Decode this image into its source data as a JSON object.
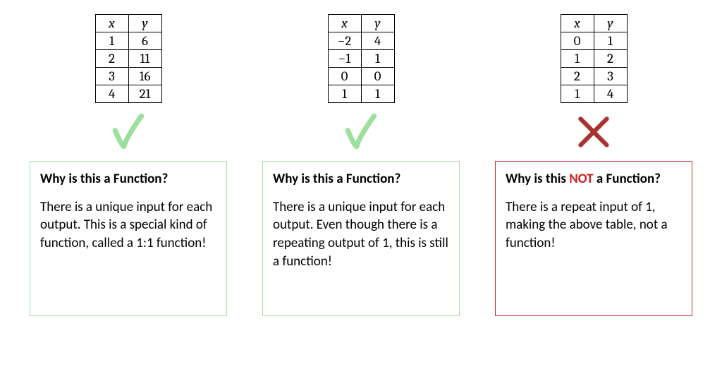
{
  "columns": [
    {
      "table": {
        "headers": [
          "x",
          "y"
        ],
        "rows": [
          [
            "1",
            "6"
          ],
          [
            "2",
            "11"
          ],
          [
            "3",
            "16"
          ],
          [
            "4",
            "21"
          ]
        ]
      },
      "mark": "check",
      "title_pre": "Why is this a Function?",
      "title_emph": "",
      "title_post": "",
      "body": "There is a unique input for each output.  This is a special kind of function, called a 1:1 function!",
      "box_class": "box-green"
    },
    {
      "table": {
        "headers": [
          "x",
          "y"
        ],
        "rows": [
          [
            "−2",
            "4"
          ],
          [
            "−1",
            "1"
          ],
          [
            "0",
            "0"
          ],
          [
            "1",
            "1"
          ]
        ]
      },
      "mark": "check",
      "title_pre": "Why is this a Function?",
      "title_emph": "",
      "title_post": "",
      "body": "There is a unique input for each output. Even though there is a repeating output of 1, this is still a function!",
      "box_class": "box-green"
    },
    {
      "table": {
        "headers": [
          "x",
          "y"
        ],
        "rows": [
          [
            "0",
            "1"
          ],
          [
            "1",
            "2"
          ],
          [
            "2",
            "3"
          ],
          [
            "1",
            "4"
          ]
        ]
      },
      "mark": "cross",
      "title_pre": "Why is this ",
      "title_emph": "NOT",
      "title_post": " a Function?",
      "body": "There is a repeat input of 1, making the above table, not a function!",
      "box_class": "box-red"
    }
  ],
  "colors": {
    "check": "#9ddf9d",
    "cross": "#a83432"
  }
}
